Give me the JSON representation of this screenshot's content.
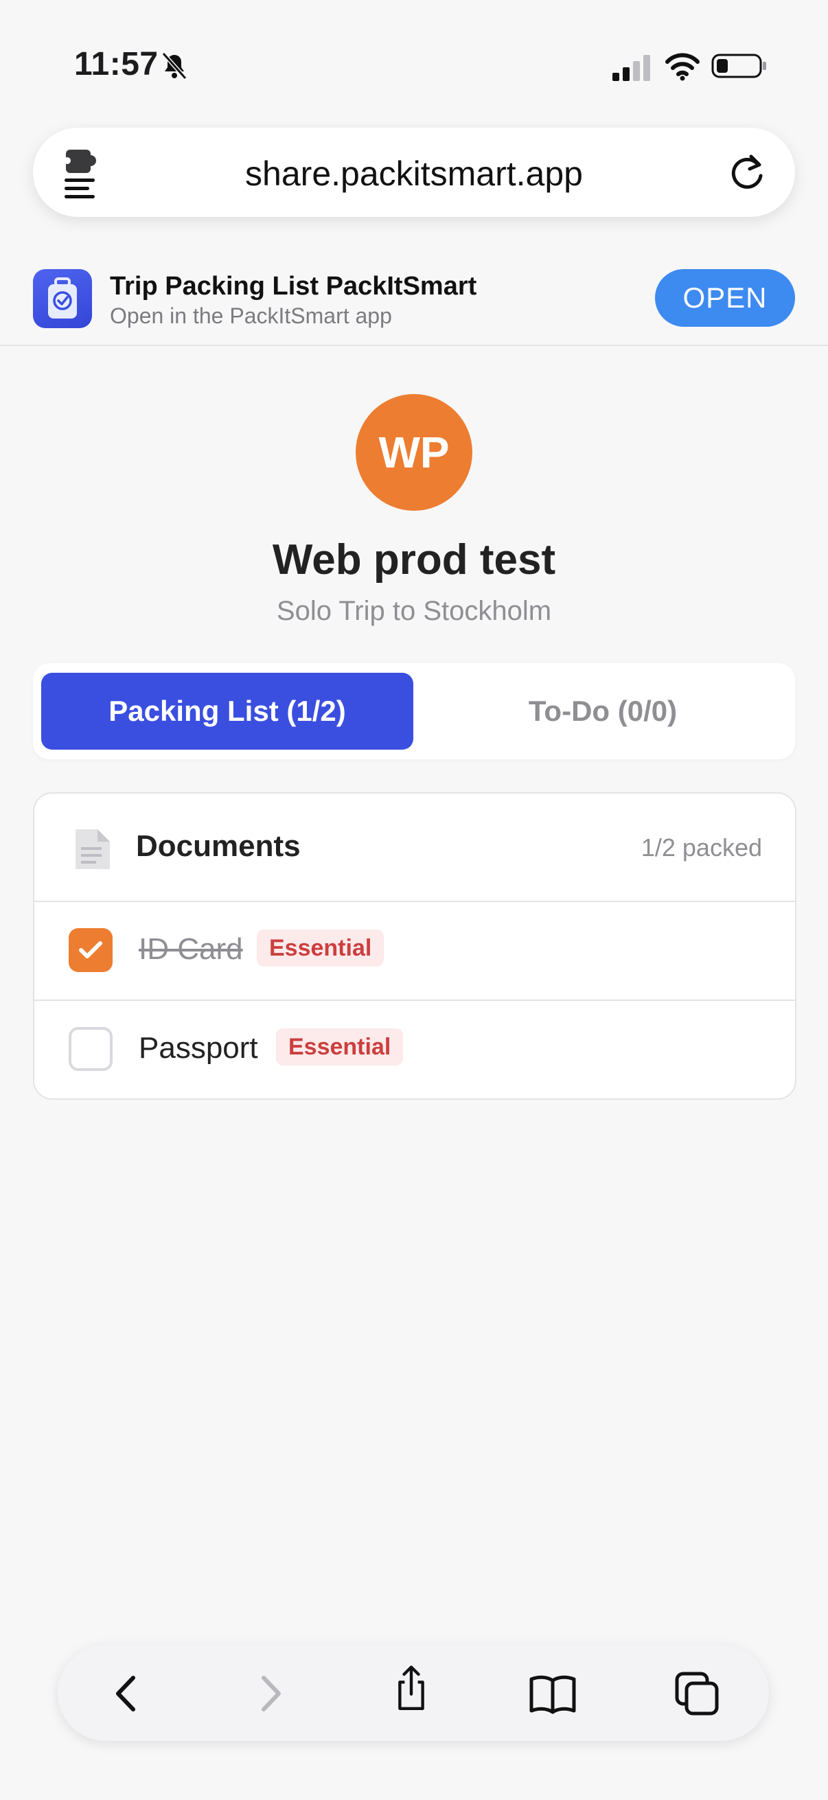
{
  "status_bar": {
    "time": "11:57",
    "icons": [
      "bell-off-icon",
      "signal-icon",
      "wifi-icon",
      "battery-icon"
    ]
  },
  "browser": {
    "url": "share.packitsmart.app",
    "icons": [
      "page-menu-icon",
      "reload-icon"
    ]
  },
  "app_banner": {
    "title": "Trip Packing List PackItSmart",
    "subtitle": "Open in the PackItSmart app",
    "open_label": "OPEN",
    "icon": "suitcase-check-icon"
  },
  "profile": {
    "initials": "WP",
    "avatar_color": "#ED7D31"
  },
  "trip": {
    "title": "Web prod test",
    "subtitle": "Solo Trip to Stockholm"
  },
  "tabs": [
    {
      "label": "Packing List (1/2)",
      "active": true
    },
    {
      "label": "To-Do (0/0)",
      "active": false
    }
  ],
  "category": {
    "name": "Documents",
    "count_label": "1/2 packed",
    "icon": "document-icon",
    "items": [
      {
        "name": "ID Card",
        "tag": "Essential",
        "packed": true
      },
      {
        "name": "Passport",
        "tag": "Essential",
        "packed": false
      }
    ]
  },
  "toolbar": {
    "buttons": [
      "back-icon",
      "forward-icon",
      "share-icon",
      "bookmarks-icon",
      "tabs-icon"
    ]
  },
  "colors": {
    "accent_blue": "#3A4FE0",
    "open_button": "#3D8AF0",
    "orange": "#ED7D31",
    "essential_tag_text": "#CC3F3F",
    "essential_tag_bg": "#FDEAEA"
  }
}
